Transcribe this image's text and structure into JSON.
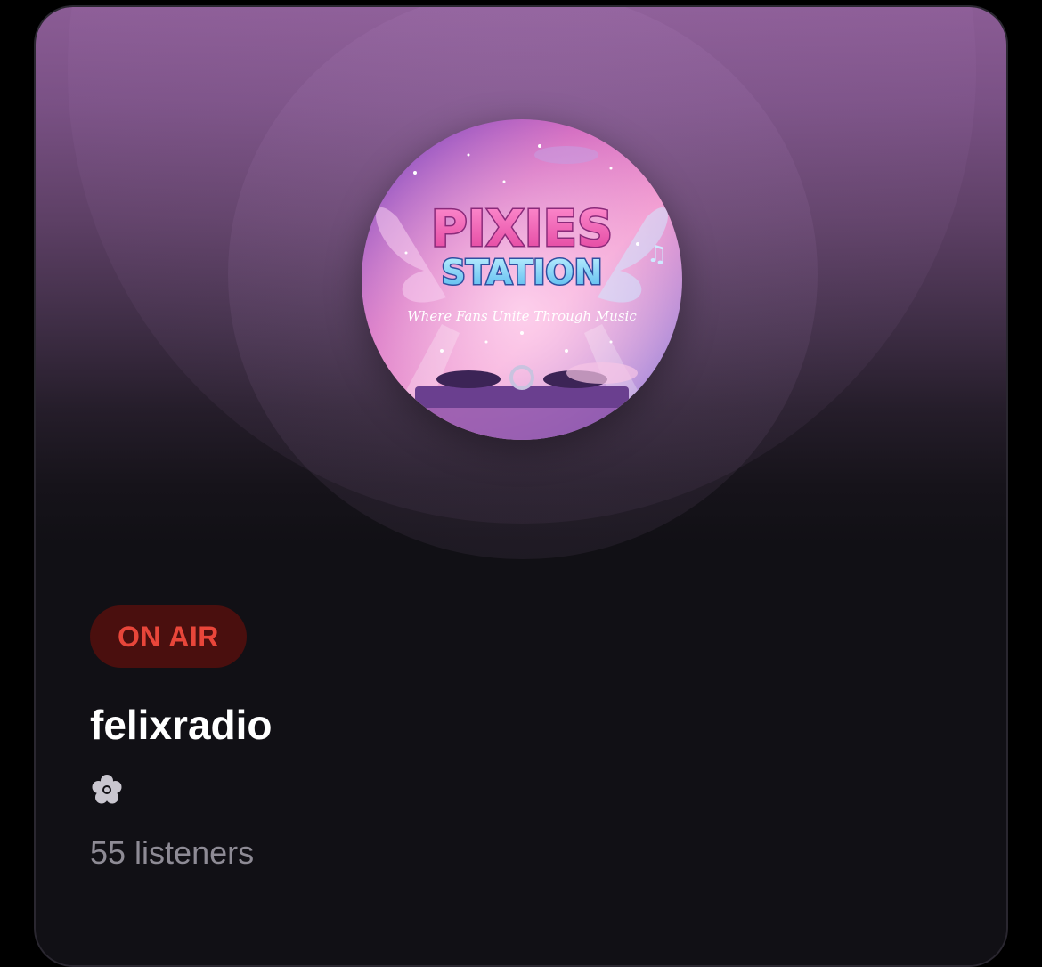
{
  "station": {
    "status_badge": "ON AIR",
    "name": "felixradio",
    "description_icon": "flower-icon",
    "listeners": "55 listeners"
  },
  "artwork": {
    "title_line1": "PIXIES",
    "title_line2": "STATION",
    "tagline": "Where Fans Unite Through Music"
  },
  "colors": {
    "badge_bg": "#4a0f0e",
    "badge_text": "#e8463a",
    "header_gradient_top": "#8b5c95",
    "card_bg": "#111015",
    "listeners_text": "#8e8b95"
  }
}
